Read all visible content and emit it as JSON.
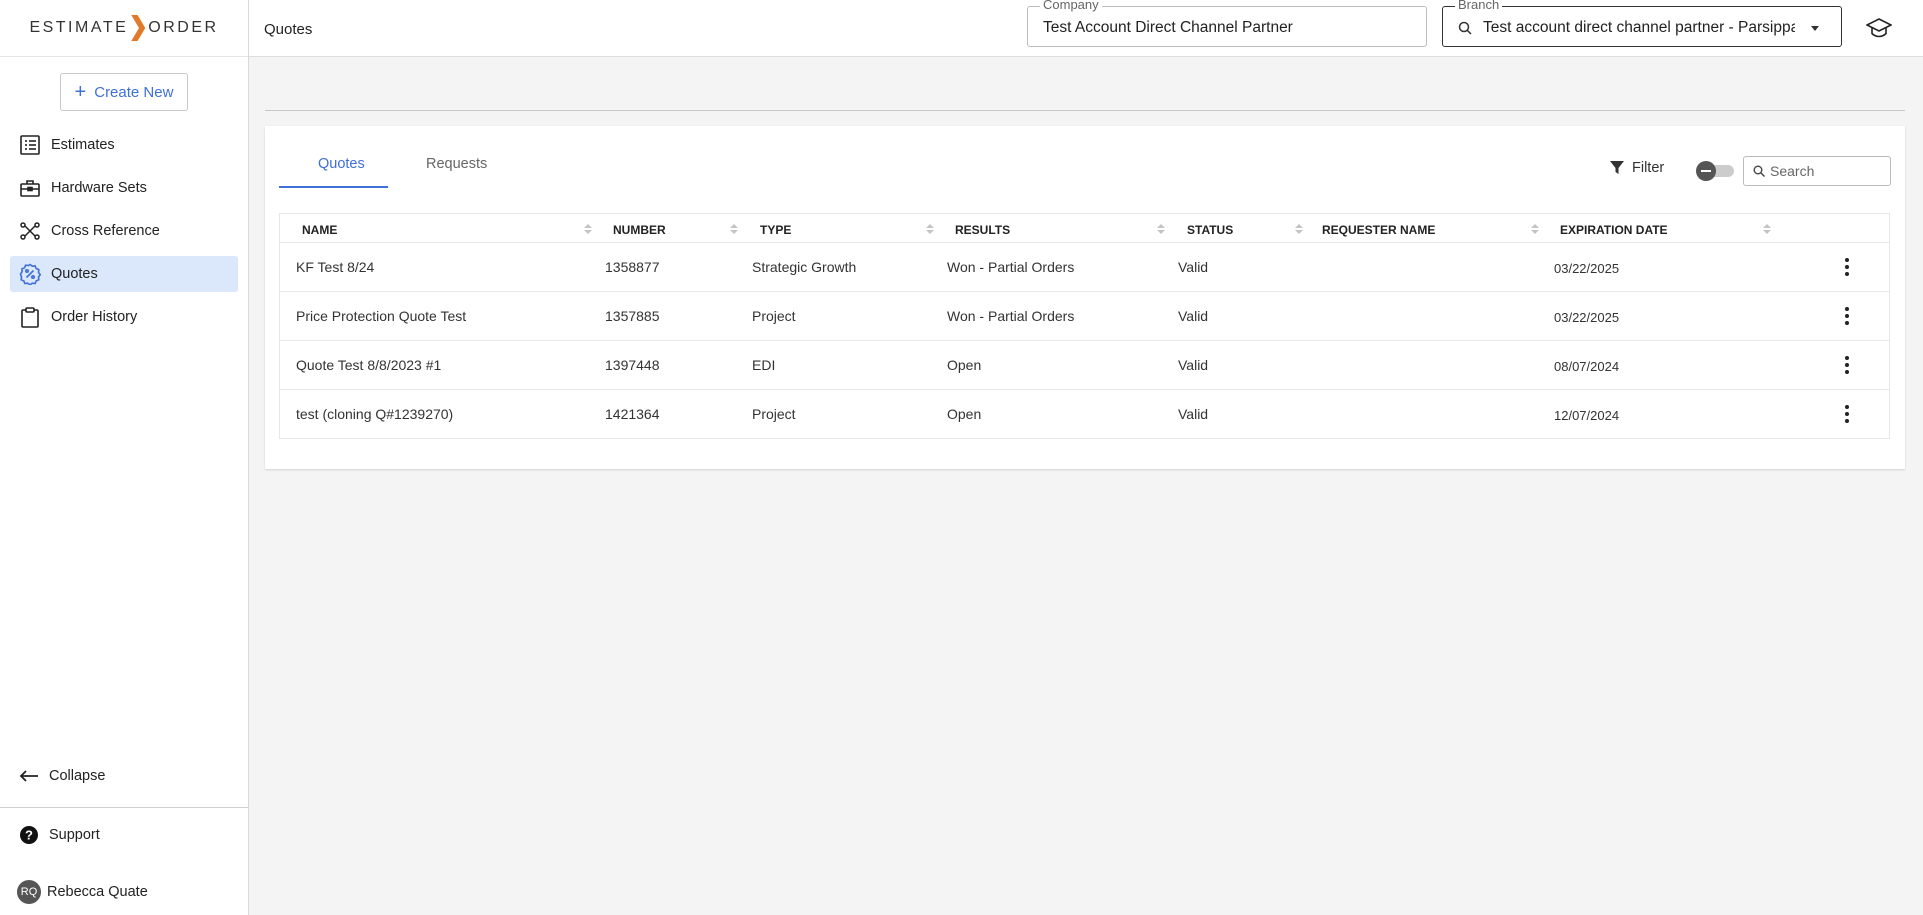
{
  "brand": {
    "left": "ESTIMATE",
    "right": "ORDER"
  },
  "sidebar": {
    "create_label": "Create New",
    "items": [
      {
        "label": "Estimates",
        "icon": "list-icon"
      },
      {
        "label": "Hardware Sets",
        "icon": "toolbox-icon"
      },
      {
        "label": "Cross Reference",
        "icon": "cross-reference-icon"
      },
      {
        "label": "Quotes",
        "icon": "quotes-icon",
        "active": true
      },
      {
        "label": "Order History",
        "icon": "clipboard-icon"
      }
    ],
    "collapse_label": "Collapse",
    "support_label": "Support",
    "user": {
      "initials": "RQ",
      "name": "Rebecca Quate"
    }
  },
  "header": {
    "title": "Quotes",
    "company": {
      "label": "Company",
      "value": "Test Account Direct Channel Partner"
    },
    "branch": {
      "label": "Branch",
      "value": "Test account direct channel partner - Parsippany"
    }
  },
  "main": {
    "tabs": [
      {
        "label": "Quotes"
      },
      {
        "label": "Requests"
      }
    ],
    "filter_label": "Filter",
    "search_placeholder": "Search",
    "columns": [
      "NAME",
      "NUMBER",
      "TYPE",
      "RESULTS",
      "STATUS",
      "REQUESTER NAME",
      "EXPIRATION DATE"
    ],
    "rows": [
      {
        "name": "KF Test 8/24",
        "number": "1358877",
        "type": "Strategic Growth",
        "results": "Won - Partial Orders",
        "status": "Valid",
        "requester": "",
        "expiration": "03/22/2025"
      },
      {
        "name": "Price Protection Quote Test",
        "number": "1357885",
        "type": "Project",
        "results": "Won - Partial Orders",
        "status": "Valid",
        "requester": "",
        "expiration": "03/22/2025"
      },
      {
        "name": "Quote Test 8/8/2023 #1",
        "number": "1397448",
        "type": "EDI",
        "results": "Open",
        "status": "Valid",
        "requester": "",
        "expiration": "08/07/2024"
      },
      {
        "name": "test (cloning Q#1239270)",
        "number": "1421364",
        "type": "Project",
        "results": "Open",
        "status": "Valid",
        "requester": "",
        "expiration": "12/07/2024"
      }
    ]
  },
  "colors": {
    "accent": "#3f6fd8",
    "brand_chevron": "#e07a2a",
    "active_nav_bg": "#dbe7fb"
  }
}
